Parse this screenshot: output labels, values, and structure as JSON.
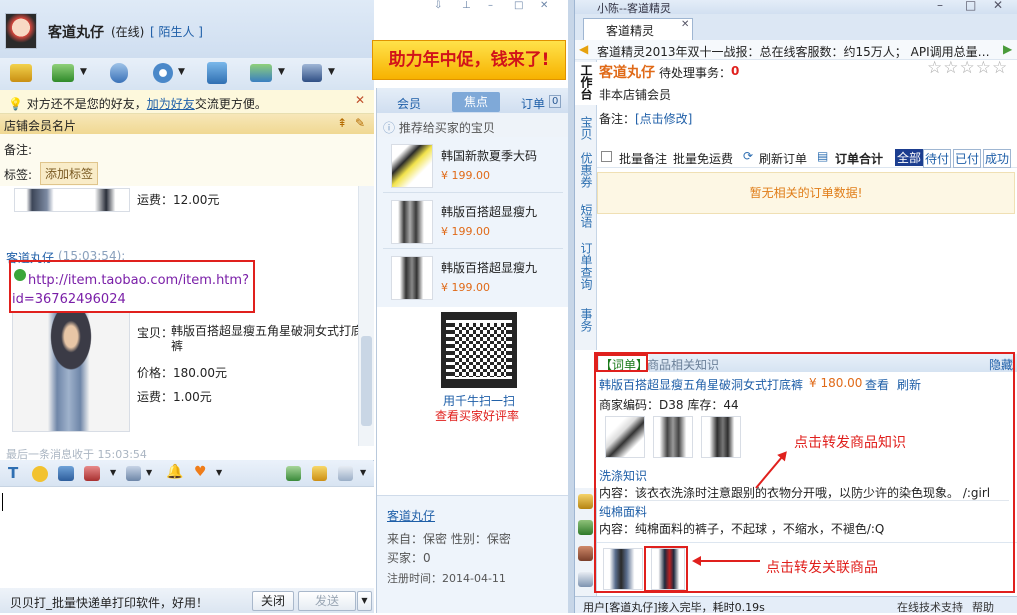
{
  "chat": {
    "contact_name": "客道丸仔",
    "status": "(在线)",
    "relation": "[ 陌生人 ]",
    "banner": "助力年中促，钱来了!",
    "notice_text": "对方还不是您的好友，",
    "notice_link": "加为好友",
    "notice_tail": "交流更方便。",
    "card_title": "店铺会员名片",
    "remark_label": "备注:",
    "tag_label": "标签:",
    "tag_button": "添加标签",
    "msg1_shipping": "运费：12.00元",
    "msg2_sender": "客道丸仔",
    "msg2_time": "(15:03:54):",
    "msg2_link_line1": "http://item.taobao.com/item.htm?",
    "msg2_link_line2": "id=36762496024",
    "msg2_item_label": "宝贝：",
    "msg2_item_name": "韩版百搭超显瘦五角星破洞女式打底裤",
    "msg2_price": "价格：180.00元",
    "msg2_shipping": "运费：1.00元",
    "last_msg": "最后一条消息收于 15:03:54",
    "footer_ad": "贝贝打_批量快递单打印软件，好用！",
    "close_btn": "关闭",
    "send_btn": "发送"
  },
  "middle": {
    "tabs": [
      "会员",
      "焦点",
      "订单"
    ],
    "order_count": "0",
    "rec_title": "推荐给买家的宝贝",
    "products": [
      {
        "name": "韩国新款夏季大码",
        "price": "¥ 199.00"
      },
      {
        "name": "韩版百搭超显瘦九",
        "price": "¥ 199.00"
      },
      {
        "name": "韩版百搭超显瘦九",
        "price": "¥ 199.00"
      }
    ],
    "qr_text": "用千牛扫一扫",
    "qr_link": "查看买家好评率",
    "buyer_name": "客道丸仔",
    "from_line": "来自：保密  性别：保密",
    "buyer_line": "买家：0",
    "reg_line": "注册时间：2014-04-11"
  },
  "right": {
    "window_title": "小陈--客道精灵",
    "tab_title": "客道精灵",
    "ticker": "客道精灵2013年双十一战报：总在线客服数：约15万人；  API调用总量…",
    "vtabs": [
      "工作台",
      "宝贝",
      "优惠券",
      "短语",
      "订单查询",
      "事务"
    ],
    "customer_name": "客道丸仔",
    "pending_label": "待处理事务：",
    "pending_count": "0",
    "member_type": "非本店铺会员",
    "remark_label": "备注：",
    "remark_link": "[点击修改]",
    "toolbar": {
      "batch_remark": "批量备注",
      "batch_free": "批量免运费",
      "refresh_orders": "刷新订单",
      "order_total": "订单合计",
      "filters": [
        "全部",
        "待付",
        "已付",
        "成功"
      ]
    },
    "empty_msg": "暂无相关的订单数据!",
    "knowledge": {
      "tab_label": "【词单】",
      "header": "商品相关知识",
      "hide": "隐藏",
      "product_name": "韩版百搭超显瘦五角星破洞女式打底裤",
      "price": "¥ 180.00",
      "view": "查看",
      "refresh": "刷新",
      "code_line": "商家编码：D38  库存：44",
      "wash_title": "洗涤知识",
      "wash_content": "内容：该衣衣洗涤时注意跟别的衣物分开哦，以防少许的染色现象。  /:girl",
      "cotton_title": "纯棉面料",
      "cotton_content": "内容：纯棉面料的裤子，不起球 ，不缩水，不褪色/:Q"
    },
    "status_bar": "用户[客道丸仔]接入完毕，耗时0.19s",
    "status_links": [
      "在线技术支持",
      "帮助"
    ]
  },
  "annotations": {
    "forward_knowledge": "点击转发商品知识",
    "forward_related": "点击转发关联商品"
  },
  "colors": {
    "accent_red": "#e0201d",
    "link_blue": "#1f5fa8",
    "header_bg": "#dbe8f6",
    "panel_bg": "#eef4fb"
  }
}
